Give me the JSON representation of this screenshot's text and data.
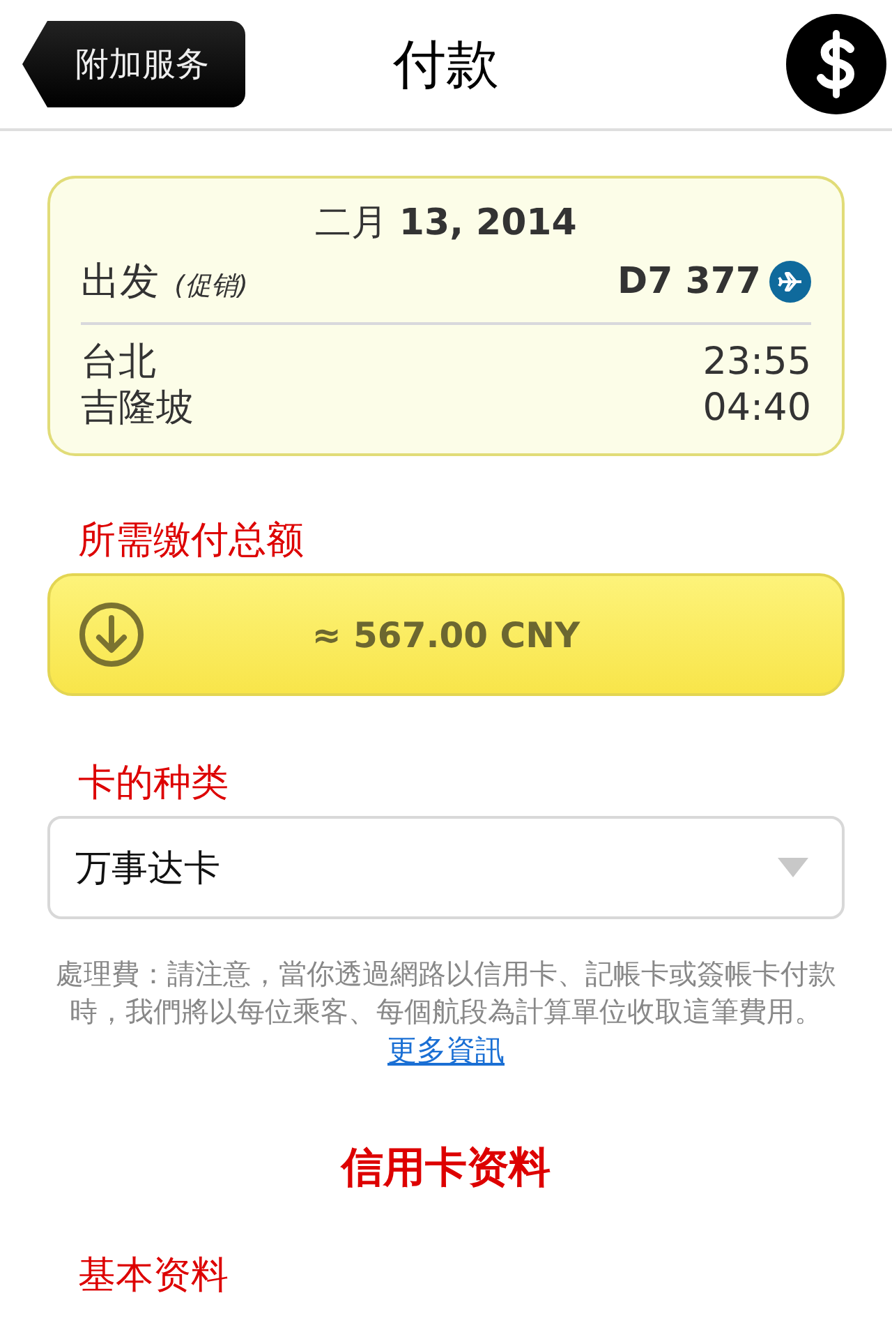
{
  "header": {
    "back_button": "附加服务",
    "title": "付款"
  },
  "flight": {
    "date": "二月 **13, 2014**",
    "direction": "出发",
    "fare_note": "(促销)",
    "flight_number": "D7 377",
    "legs": [
      {
        "city": "台北",
        "time": "23:55"
      },
      {
        "city": "吉隆坡",
        "time": "04:40"
      }
    ]
  },
  "total": {
    "label": "所需缴付总额",
    "amount": "≈ 567.00 CNY"
  },
  "card_type": {
    "label": "卡的种类",
    "value": "万事达卡"
  },
  "fee_note": {
    "text": "處理費：請注意，當你透過網路以信用卡、記帳卡或簽帳卡付款時，我們將以每位乘客、每個航段為計算單位收取這筆費用。",
    "link": "更多資訊"
  },
  "section_title": "信用卡资料",
  "subsection_title": "基本资料"
}
